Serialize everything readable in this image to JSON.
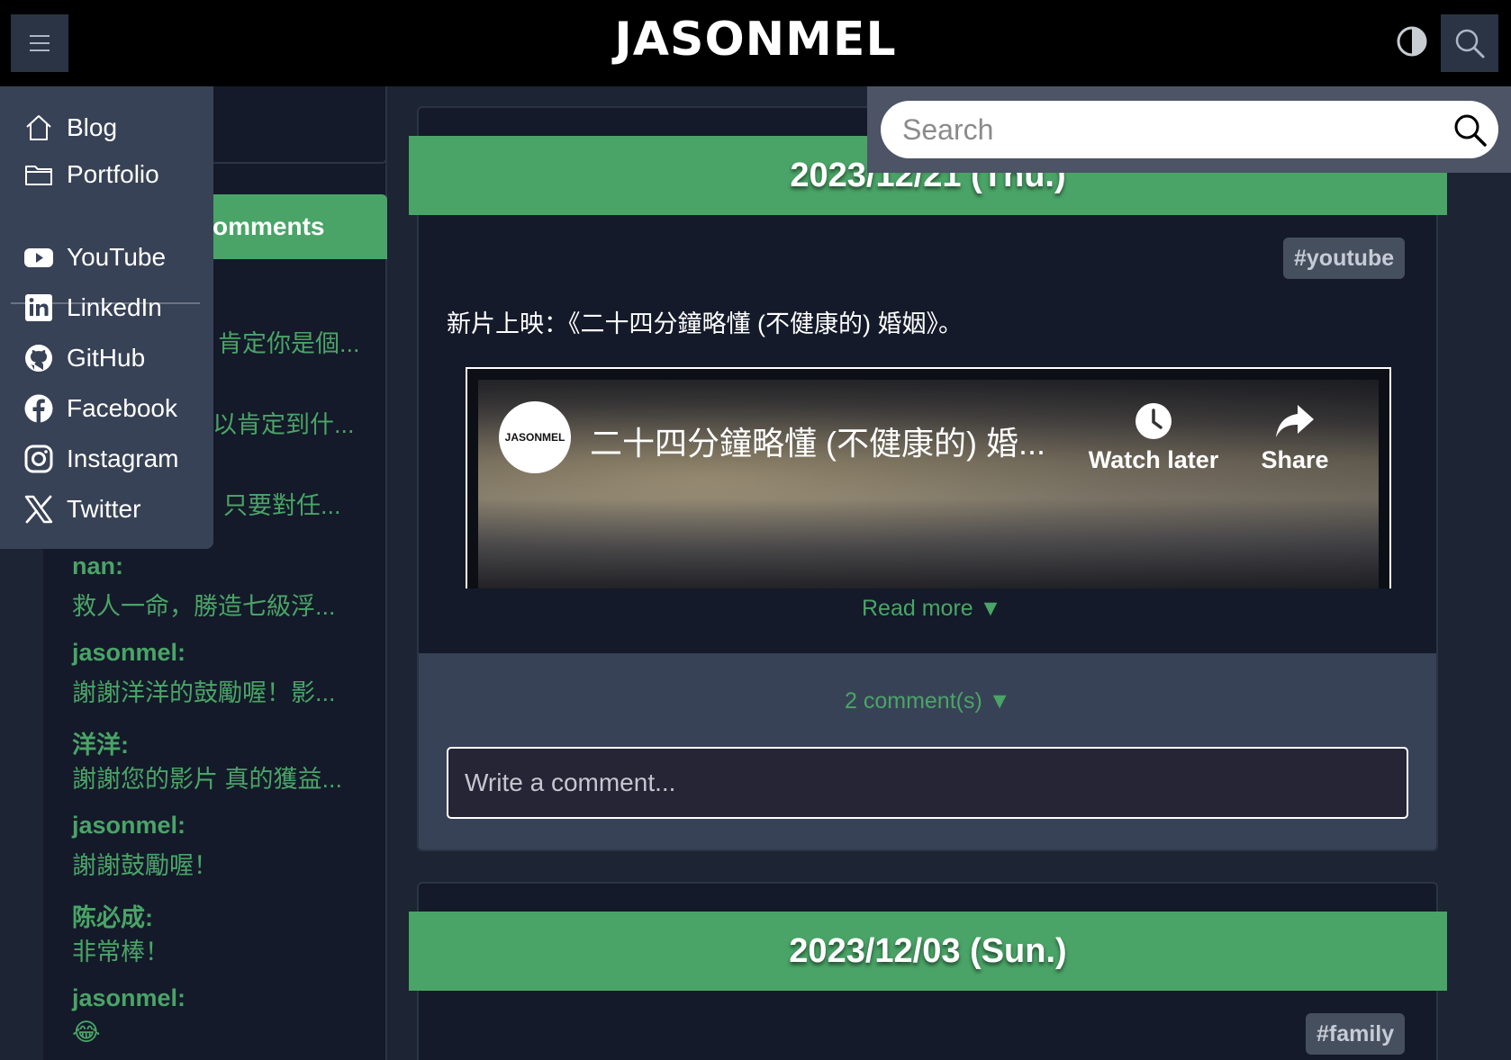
{
  "header": {
    "logo": "JASONMEL"
  },
  "nav": {
    "items": [
      {
        "label": "Blog",
        "icon": "house-icon"
      },
      {
        "label": "Portfolio",
        "icon": "folder-icon"
      },
      {
        "label": "YouTube",
        "icon": "youtube-icon"
      },
      {
        "label": "LinkedIn",
        "icon": "linkedin-icon"
      },
      {
        "label": "GitHub",
        "icon": "github-icon"
      },
      {
        "label": "Facebook",
        "icon": "facebook-icon"
      },
      {
        "label": "Instagram",
        "icon": "instagram-icon"
      },
      {
        "label": "Twitter",
        "icon": "x-icon"
      }
    ]
  },
  "search": {
    "placeholder": "Search"
  },
  "sidebar": {
    "recent_title": "omments",
    "partial_texts": [
      "肯定你是個...",
      "以肯定到什...",
      "只要對任..."
    ],
    "comments": [
      {
        "author": "nan:",
        "text": "救人一命，勝造七級浮..."
      },
      {
        "author": "jasonmel:",
        "text": "謝謝洋洋的鼓勵喔！影..."
      },
      {
        "author": "洋洋:",
        "text": "謝謝您的影片 真的獲益..."
      },
      {
        "author": "jasonmel:",
        "text": "謝謝鼓勵喔！"
      },
      {
        "author": "陈必成:",
        "text": "非常棒！"
      },
      {
        "author": "jasonmel:",
        "text": "😂"
      }
    ]
  },
  "posts": [
    {
      "date": "2023/12/21 (Thu.)",
      "tag": "#youtube",
      "text": "新片上映：《二十四分鐘略懂 (不健康的) 婚姻》。",
      "video": {
        "channel": "JASONMEL",
        "title": "二十四分鐘略懂 (不健康的) 婚...",
        "watch_later": "Watch later",
        "share": "Share"
      },
      "read_more": "Read more ▼",
      "comments_label": "2 comment(s) ▼",
      "comment_placeholder": "Write a comment..."
    },
    {
      "date": "2023/12/03 (Sun.)",
      "tag": "#family"
    }
  ],
  "colors": {
    "accent": "#4aa467",
    "background": "#1d2433",
    "card": "#141a29"
  }
}
